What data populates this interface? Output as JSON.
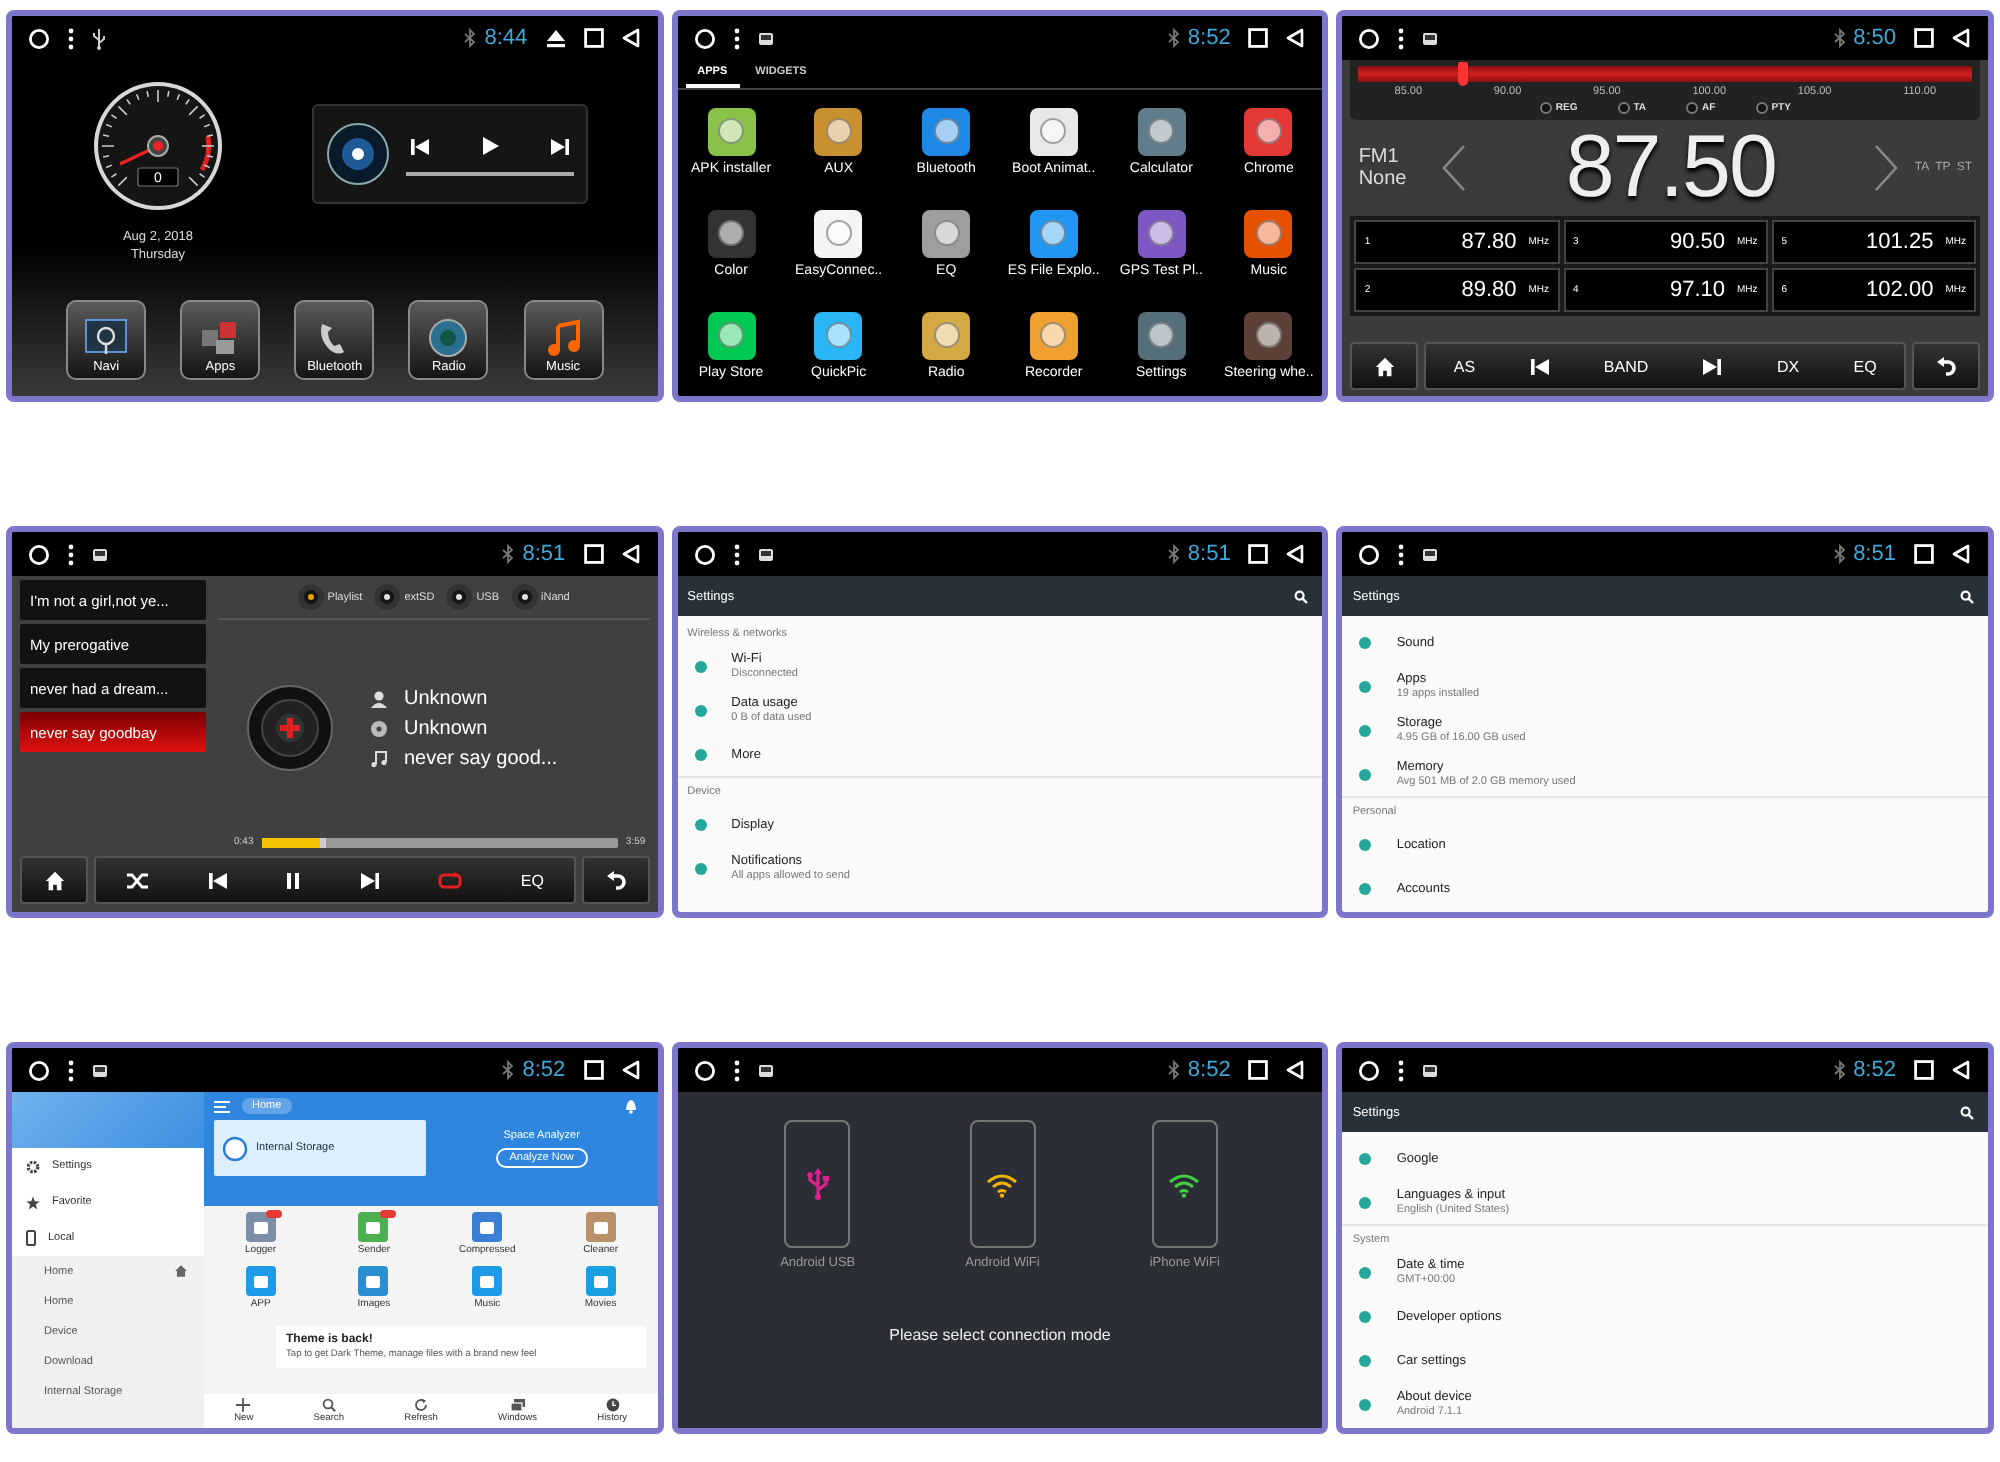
{
  "panels": [
    {
      "kind": "home",
      "status_bar": {
        "usb": true,
        "time": "8:44",
        "eject": true
      },
      "speed_reading": "0",
      "date": "Aug 2, 2018",
      "weekday": "Thursday",
      "dock": [
        {
          "label": "Navi",
          "kind": "navi"
        },
        {
          "label": "Apps",
          "kind": "apps"
        },
        {
          "label": "Bluetooth",
          "kind": "phone"
        },
        {
          "label": "Radio",
          "kind": "radio"
        },
        {
          "label": "Music",
          "kind": "music"
        }
      ]
    },
    {
      "kind": "apps",
      "status_bar": {
        "usb": false,
        "time": "8:52",
        "eject": false
      },
      "tabs": [
        {
          "label": "APPS",
          "selected": true
        },
        {
          "label": "WIDGETS",
          "selected": false
        }
      ],
      "apps": [
        {
          "label": "APK installer",
          "color": "#8bc34a"
        },
        {
          "label": "AUX",
          "color": "#c8902e"
        },
        {
          "label": "Bluetooth",
          "color": "#1e88e5"
        },
        {
          "label": "Boot Animat..",
          "color": "#e8e8e8"
        },
        {
          "label": "Calculator",
          "color": "#607d8b"
        },
        {
          "label": "Chrome",
          "color": "#e53935"
        },
        {
          "label": "Color",
          "color": "#333333"
        },
        {
          "label": "EasyConnec..",
          "color": "#f5f5f5"
        },
        {
          "label": "EQ",
          "color": "#9e9e9e"
        },
        {
          "label": "ES File Explo..",
          "color": "#2196f3"
        },
        {
          "label": "GPS Test Pl..",
          "color": "#7e57c2"
        },
        {
          "label": "Music",
          "color": "#e65100"
        },
        {
          "label": "Play Store",
          "color": "#00c853"
        },
        {
          "label": "QuickPic",
          "color": "#29b6f6"
        },
        {
          "label": "Radio",
          "color": "#d4a843"
        },
        {
          "label": "Recorder",
          "color": "#f0a030"
        },
        {
          "label": "Settings",
          "color": "#546e7a"
        },
        {
          "label": "Steering whe..",
          "color": "#5d4037"
        }
      ]
    },
    {
      "kind": "radio",
      "status_bar": {
        "usb": false,
        "time": "8:50",
        "eject": false
      },
      "tuner": {
        "level": 0.17
      },
      "scale": [
        "85.00",
        "90.00",
        "95.00",
        "100.00",
        "105.00",
        "110.00"
      ],
      "options": [
        "REG",
        "TA",
        "AF",
        "PTY"
      ],
      "band": "FM1",
      "station": "None",
      "frequency": "87.50",
      "flags": [
        "TA",
        "TP",
        "ST"
      ],
      "presets": [
        {
          "number": "1",
          "frequency": "87.80",
          "unit": "MHz"
        },
        {
          "number": "2",
          "frequency": "89.80",
          "unit": "MHz"
        },
        {
          "number": "3",
          "frequency": "90.50",
          "unit": "MHz"
        },
        {
          "number": "4",
          "frequency": "97.10",
          "unit": "MHz"
        },
        {
          "number": "5",
          "frequency": "101.25",
          "unit": "MHz"
        },
        {
          "number": "6",
          "frequency": "102.00",
          "unit": "MHz"
        }
      ],
      "controls": [
        {
          "kind": "home"
        },
        {
          "kind": "as",
          "label": "AS"
        },
        {
          "kind": "prev"
        },
        {
          "kind": "band",
          "label": "BAND"
        },
        {
          "kind": "next"
        },
        {
          "kind": "dx",
          "label": "DX"
        },
        {
          "kind": "eq",
          "label": "EQ"
        },
        {
          "kind": "back"
        }
      ]
    },
    {
      "kind": "music",
      "status_bar": {
        "usb": false,
        "time": "8:51",
        "eject": false
      },
      "playlist": [
        {
          "title": "I'm not a girl,not ye...",
          "selected": false
        },
        {
          "title": "My prerogative",
          "selected": false
        },
        {
          "title": "never had a dream...",
          "selected": false
        },
        {
          "title": "never say goodbay",
          "selected": true
        }
      ],
      "sources": [
        {
          "label": "Playlist",
          "selected": true
        },
        {
          "label": "extSD",
          "selected": false
        },
        {
          "label": "USB",
          "selected": false
        },
        {
          "label": "iNand",
          "selected": false
        }
      ],
      "artist": "Unknown",
      "album": "Unknown",
      "title": "never say good...",
      "elapsed": "0:43",
      "total": "3:59",
      "progress": {
        "level": 0.18
      },
      "controls": [
        {
          "kind": "home"
        },
        {
          "kind": "shuffle"
        },
        {
          "kind": "prev"
        },
        {
          "kind": "pause"
        },
        {
          "kind": "next"
        },
        {
          "kind": "repeat",
          "on": true
        },
        {
          "kind": "eq",
          "label": "EQ"
        },
        {
          "kind": "back"
        }
      ]
    },
    {
      "kind": "settings",
      "status_bar": {
        "usb": false,
        "time": "8:51",
        "eject": false
      },
      "title": "Settings",
      "entries": [
        {
          "kind": "header",
          "label": "Wireless & networks"
        },
        {
          "kind": "item",
          "title": "Wi-Fi",
          "subtitle": "Disconnected"
        },
        {
          "kind": "item",
          "title": "Data usage",
          "subtitle": "0 B of data used"
        },
        {
          "kind": "item",
          "title": "More"
        },
        {
          "kind": "header",
          "label": "Device"
        },
        {
          "kind": "item",
          "title": "Display"
        },
        {
          "kind": "item",
          "title": "Notifications",
          "subtitle": "All apps allowed to send"
        }
      ]
    },
    {
      "kind": "settings",
      "status_bar": {
        "usb": false,
        "time": "8:51",
        "eject": false
      },
      "title": "Settings",
      "entries": [
        {
          "kind": "item",
          "title": "Sound"
        },
        {
          "kind": "item",
          "title": "Apps",
          "subtitle": "19 apps installed"
        },
        {
          "kind": "item",
          "title": "Storage",
          "subtitle": "4.95 GB of 16.00 GB used"
        },
        {
          "kind": "item",
          "title": "Memory",
          "subtitle": "Avg 501 MB of 2.0 GB memory used"
        },
        {
          "kind": "header",
          "label": "Personal"
        },
        {
          "kind": "item",
          "title": "Location"
        },
        {
          "kind": "item",
          "title": "Accounts"
        }
      ]
    },
    {
      "kind": "files",
      "status_bar": {
        "usb": false,
        "time": "8:52",
        "eject": false
      },
      "sidebar": [
        {
          "label": "Settings",
          "kind": "gear"
        },
        {
          "label": "Favorite",
          "kind": "star"
        },
        {
          "label": "Local",
          "kind": "phone"
        }
      ],
      "locations": [
        {
          "label": "Home",
          "home_icon": true
        },
        {
          "label": "Home",
          "home_icon": false
        },
        {
          "label": "Device",
          "home_icon": false
        },
        {
          "label": "Download",
          "home_icon": false
        },
        {
          "label": "Internal Storage",
          "home_icon": false
        }
      ],
      "chip": "Home",
      "storage": "Internal Storage",
      "analyzer": "Space Analyzer",
      "analyze_button": "Analyze Now",
      "tools": [
        {
          "label": "Logger",
          "color": "#7d8fa8",
          "badge": true
        },
        {
          "label": "Sender",
          "color": "#4caf50",
          "badge": true
        },
        {
          "label": "Compressed",
          "color": "#3b7fd4",
          "badge": false
        },
        {
          "label": "Cleaner",
          "color": "#b8906a",
          "badge": false
        },
        {
          "label": "APP",
          "color": "#1e9be8",
          "badge": false
        },
        {
          "label": "Images",
          "color": "#2a8fd0",
          "badge": false
        },
        {
          "label": "Music",
          "color": "#1e9be8",
          "badge": false
        },
        {
          "label": "Movies",
          "color": "#1aa0e0",
          "badge": false
        }
      ],
      "notice_title": "Theme is back!",
      "notice_text": "Tap to get Dark Theme, manage files with a brand new feel",
      "bottom": [
        {
          "label": "New",
          "kind": "plus"
        },
        {
          "label": "Search",
          "kind": "search"
        },
        {
          "label": "Refresh",
          "kind": "refresh"
        },
        {
          "label": "Windows",
          "kind": "windows"
        },
        {
          "label": "History",
          "kind": "history"
        }
      ]
    },
    {
      "kind": "connect",
      "status_bar": {
        "usb": false,
        "time": "8:52",
        "eject": false
      },
      "modes": [
        {
          "label": "Android USB",
          "kind": "usb",
          "color": "#e0208c"
        },
        {
          "label": "Android WiFi",
          "kind": "wifi",
          "color": "#f0b400"
        },
        {
          "label": "iPhone WiFi",
          "kind": "wifi",
          "color": "#3fcf3f"
        }
      ],
      "message": "Please select connection mode"
    },
    {
      "kind": "settings",
      "status_bar": {
        "usb": false,
        "time": "8:52",
        "eject": false
      },
      "title": "Settings",
      "entries": [
        {
          "kind": "item",
          "title": "Google"
        },
        {
          "kind": "item",
          "title": "Languages & input",
          "subtitle": "English (United States)"
        },
        {
          "kind": "header",
          "label": "System"
        },
        {
          "kind": "item",
          "title": "Date & time",
          "subtitle": "GMT+00:00"
        },
        {
          "kind": "item",
          "title": "Developer options"
        },
        {
          "kind": "item",
          "title": "Car settings"
        },
        {
          "kind": "item",
          "title": "About device",
          "subtitle": "Android 7.1.1"
        }
      ]
    }
  ]
}
